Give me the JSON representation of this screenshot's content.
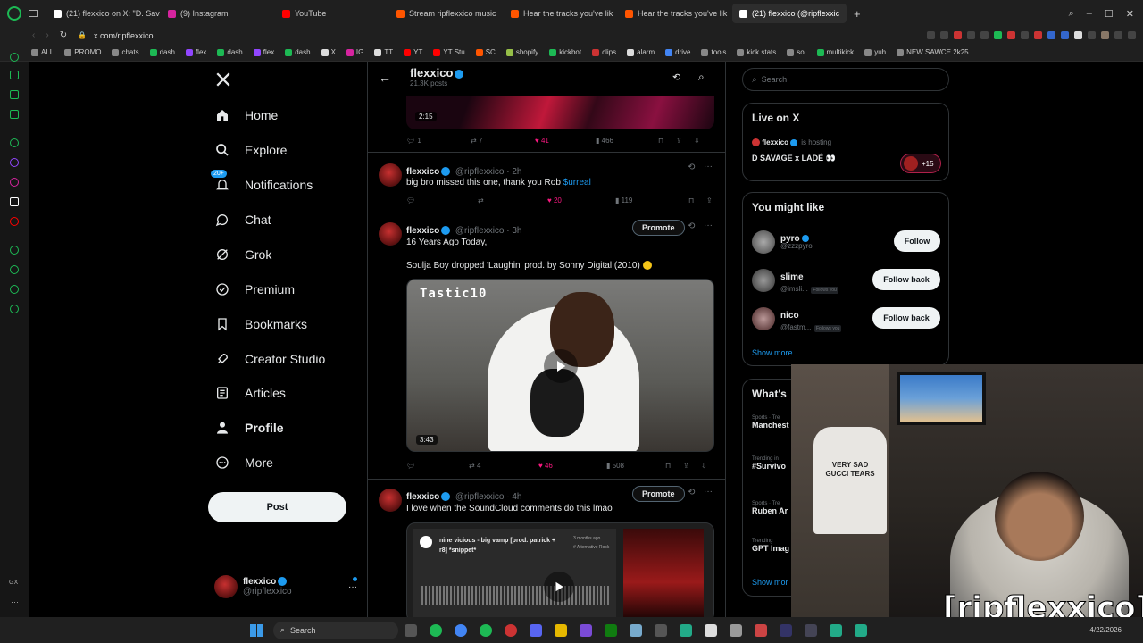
{
  "browser": {
    "tabs": [
      {
        "label": "(21) flexxico on X: \"D. Sav",
        "active": false
      },
      {
        "label": "(9) Instagram",
        "active": false
      },
      {
        "label": "YouTube",
        "active": false
      },
      {
        "label": "Stream ripflexxico music",
        "active": false
      },
      {
        "label": "Hear the tracks you've lik",
        "active": false
      },
      {
        "label": "Hear the tracks you've lik",
        "active": false
      },
      {
        "label": "(21) flexxico (@ripflexxic",
        "active": true
      }
    ],
    "url": "x.com/ripflexxico",
    "bookmarks": [
      "ALL",
      "PROMO",
      "chats",
      "dash",
      "flex",
      "dash",
      "flex",
      "dash",
      "X",
      "IG",
      "TT",
      "YT",
      "YT Stu",
      "SC",
      "shopify",
      "kickbot",
      "clips",
      "alarm",
      "drive",
      "tools",
      "kick stats",
      "sol",
      "multikick",
      "yuh",
      "NEW SAWCE 2k25"
    ]
  },
  "nav": {
    "items": [
      {
        "label": "Home",
        "icon": "home-icon"
      },
      {
        "label": "Explore",
        "icon": "search-icon"
      },
      {
        "label": "Notifications",
        "icon": "bell-icon",
        "badge": "20+"
      },
      {
        "label": "Chat",
        "icon": "chat-icon"
      },
      {
        "label": "Grok",
        "icon": "grok-icon"
      },
      {
        "label": "Premium",
        "icon": "premium-icon"
      },
      {
        "label": "Bookmarks",
        "icon": "bookmark-icon"
      },
      {
        "label": "Creator Studio",
        "icon": "rocket-icon"
      },
      {
        "label": "Articles",
        "icon": "article-icon"
      },
      {
        "label": "Profile",
        "icon": "person-icon"
      },
      {
        "label": "More",
        "icon": "more-icon"
      }
    ],
    "post_label": "Post",
    "account_name": "flexxico",
    "account_handle": "@ripflexxico"
  },
  "profile_header": {
    "name": "flexxico",
    "posts": "21.3K posts"
  },
  "tweets": [
    {
      "duration": "2:15",
      "replies": "1",
      "retweets": "7",
      "likes": "41",
      "views": "466"
    },
    {
      "name": "flexxico",
      "handle": "@ripflexxico",
      "time": "2h",
      "text": "big bro missed this one, thank you Rob",
      "link": "$urreal",
      "retweets": "",
      "likes": "20",
      "views": "119"
    },
    {
      "name": "flexxico",
      "handle": "@ripflexxico",
      "time": "3h",
      "promote": "Promote",
      "line1": "16 Years Ago Today,",
      "line2": "Soulja Boy dropped 'Laughin' prod. by Sonny Digital (2010)",
      "video_text": "Tastic10",
      "duration": "3:43",
      "retweets": "4",
      "likes": "46",
      "views": "508"
    },
    {
      "name": "flexxico",
      "handle": "@ripflexxico",
      "time": "4h",
      "promote": "Promote",
      "text": "I love when the SoundCloud comments do this lmao",
      "sc_title": "nine vicious - big vamp [prod. patrick + r8] *snippet*",
      "sc_meta": "3 months ago",
      "sc_tag": "# Alternative Rock"
    }
  ],
  "sidebar": {
    "search_placeholder": "Search",
    "live_title": "Live on X",
    "live_host": "flexxico",
    "live_hosting": "is hosting",
    "live_space": "D SAVAGE x LADÉ 👀",
    "live_count": "+15",
    "suggest_title": "You might like",
    "suggestions": [
      {
        "name": "pyro",
        "handle": "@zzzpyro",
        "follows_you": "",
        "button": "Follow"
      },
      {
        "name": "slime",
        "handle": "@imsli...",
        "follows_you": "Follows you",
        "button": "Follow back"
      },
      {
        "name": "nico",
        "handle": "@fastm...",
        "follows_you": "Follows you",
        "button": "Follow back"
      }
    ],
    "show_more": "Show more",
    "whats_title": "What's",
    "trends": [
      {
        "context": "Sports · Tre",
        "name": "Manchest"
      },
      {
        "context": "Trending in",
        "name": "#Survivo"
      },
      {
        "context": "Sports · Tre",
        "name": "Ruben Ar"
      },
      {
        "context": "Trending",
        "name": "GPT Imag"
      }
    ],
    "show_more_2": "Show mor"
  },
  "overlay": {
    "name_tag": "[ripflexxico]",
    "shirt_text": "VERY SAD GUCCI TEARS"
  },
  "taskbar": {
    "search": "Search",
    "date": "4/22/2026"
  }
}
